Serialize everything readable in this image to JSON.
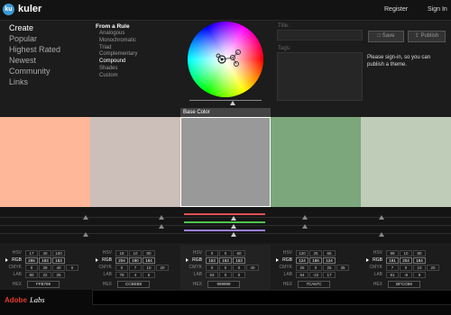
{
  "app": {
    "logo_text": "ku",
    "name": "kuler"
  },
  "header": {
    "register": "Register",
    "sign_in": "Sign In"
  },
  "nav": [
    "Create",
    "Popular",
    "Highest Rated",
    "Newest",
    "Community",
    "Links"
  ],
  "rules": {
    "heading": "From a Rule",
    "items": [
      "Analogous",
      "Monochromatic",
      "Triad",
      "Complementary",
      "Compound",
      "Shades",
      "Custom"
    ],
    "selected": "Compound"
  },
  "form": {
    "title_label": "Title:",
    "tags_label": "Tags:",
    "save_label": "Save",
    "publish_label": "Publish",
    "signin_message": "Please sign-in, so you can publish a theme."
  },
  "base_color_label": "Base Color",
  "labels": {
    "hsv": "HSV",
    "rgb": "RGB",
    "cmyk": "CMYK",
    "lab": "LAB",
    "hex": "HEX"
  },
  "swatches": [
    {
      "color": "#FFB799",
      "hsv": [
        "17",
        "40",
        "100"
      ],
      "rgb": [
        "255",
        "183",
        "153"
      ],
      "cmyk": [
        "0",
        "28",
        "40",
        "0"
      ],
      "lab": [
        "80",
        "22",
        "25"
      ],
      "hex": "FFB799"
    },
    {
      "color": "#CCBEB8",
      "hsv": [
        "18",
        "10",
        "80"
      ],
      "rgb": [
        "204",
        "190",
        "184"
      ],
      "cmyk": [
        "0",
        "7",
        "10",
        "20"
      ],
      "lab": [
        "78",
        "4",
        "5"
      ],
      "hex": "CCBEB8"
    },
    {
      "color": "#999999",
      "hsv": [
        "0",
        "0",
        "60"
      ],
      "rgb": [
        "153",
        "153",
        "153"
      ],
      "cmyk": [
        "0",
        "0",
        "0",
        "40"
      ],
      "lab": [
        "63",
        "0",
        "0"
      ],
      "hex": "999999"
    },
    {
      "color": "#7CA67C",
      "hsv": [
        "120",
        "25",
        "65"
      ],
      "rgb": [
        "124",
        "166",
        "124"
      ],
      "cmyk": [
        "25",
        "0",
        "25",
        "35"
      ],
      "lab": [
        "64",
        "-22",
        "17"
      ],
      "hex": "7CA67C"
    },
    {
      "color": "#BFCCB8",
      "hsv": [
        "99",
        "10",
        "80"
      ],
      "rgb": [
        "191",
        "204",
        "184"
      ],
      "cmyk": [
        "7",
        "0",
        "10",
        "20"
      ],
      "lab": [
        "81",
        "-8",
        "9"
      ],
      "hex": "BFCCB8"
    }
  ],
  "mixer_colors": {
    "red": "#e05050",
    "green": "#50c050",
    "blue": "#9a7fe0"
  },
  "footer": {
    "brand": "Adobe",
    "labs": "Labs"
  }
}
